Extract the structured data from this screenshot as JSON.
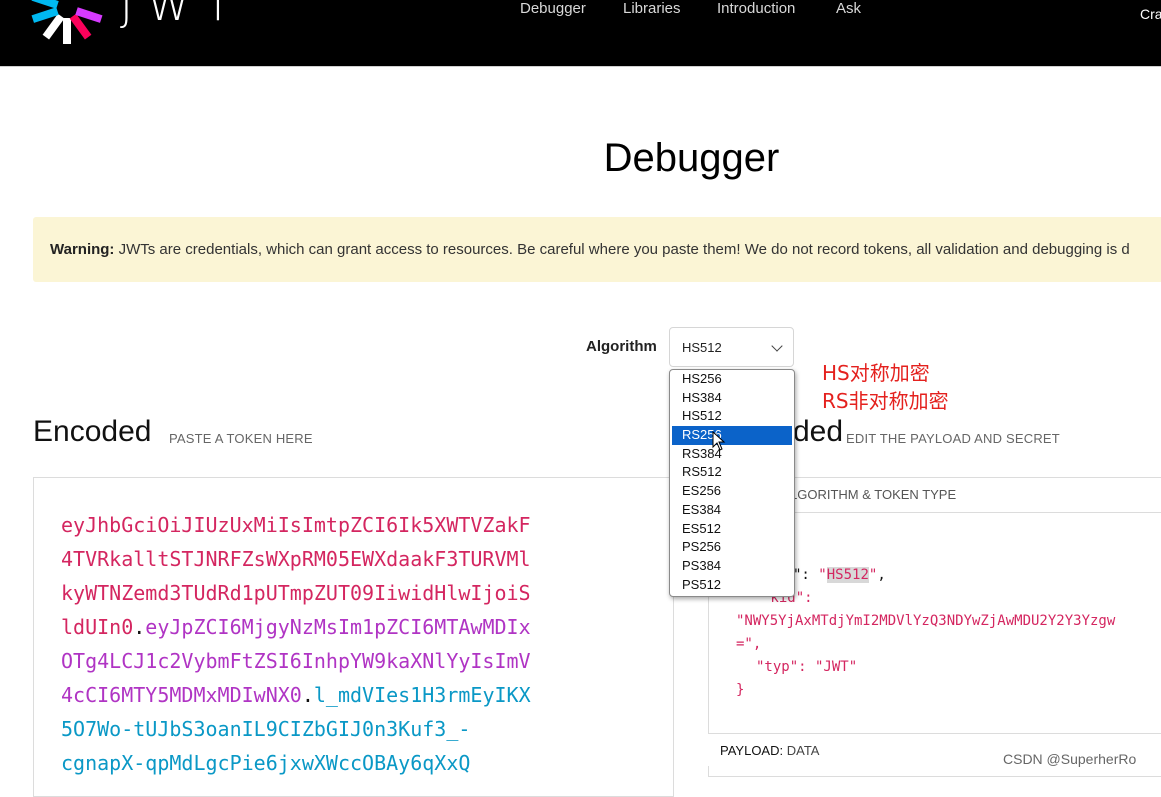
{
  "nav": {
    "brand": "JWT",
    "items": [
      "Debugger",
      "Libraries",
      "Introduction",
      "Ask"
    ],
    "right_label": "Cra"
  },
  "page": {
    "title": "Debugger"
  },
  "warning": {
    "label": "Warning:",
    "text": "JWTs are credentials, which can grant access to resources. Be careful where you paste them! We do not record tokens, all validation and debugging is d"
  },
  "algorithm": {
    "label": "Algorithm",
    "selected": "HS512",
    "options": [
      "HS256",
      "HS384",
      "HS512",
      "RS256",
      "RS384",
      "RS512",
      "ES256",
      "ES384",
      "ES512",
      "PS256",
      "PS384",
      "PS512"
    ],
    "highlighted": "RS256"
  },
  "annotations": {
    "line1": "HS对称加密",
    "line2": "RS非对称加密"
  },
  "encoded": {
    "heading": "Encoded",
    "sub": "PASTE A TOKEN HERE",
    "lines": [
      [
        {
          "t": "eyJhbGciOiJIUzUxMiIsImtpZCI6Ik5XWTVZakF",
          "c": "h"
        }
      ],
      [
        {
          "t": "4TVRkalltSTJNRFZsWXpRM05EWXdaakF3TURVMl",
          "c": "h"
        }
      ],
      [
        {
          "t": "kyWTNZemd3TUdRd1pUTmpZUT09IiwidHlwIjoiS",
          "c": "h"
        }
      ],
      [
        {
          "t": "ldUIn0",
          "c": "h"
        },
        {
          "t": ".",
          "c": "d"
        },
        {
          "t": "eyJpZCI6MjgyNzMsIm1pZCI6MTAwMDIx",
          "c": "p"
        }
      ],
      [
        {
          "t": "OTg4LCJ1c2VybmFtZSI6InhpYW9kaXNlYyIsImV",
          "c": "p"
        }
      ],
      [
        {
          "t": "4cCI6MTY5MDMxMDIwNX0",
          "c": "p"
        },
        {
          "t": ".",
          "c": "d"
        },
        {
          "t": "l_mdVIes1H3rmEyIKX",
          "c": "s"
        }
      ],
      [
        {
          "t": "5O7Wo-tUJbS3oanIL9CIZbGIJ0n3Kuf3_-",
          "c": "s"
        }
      ],
      [
        {
          "t": "cgnapX-qpMdLgcPie6jxwXWccOBAy6qXxQ",
          "c": "s"
        }
      ]
    ]
  },
  "decoded": {
    "heading_visible": "ded",
    "sub": "EDIT THE PAYLOAD AND SECRET",
    "header_label": "LGORITHM & TOKEN TYPE",
    "json_alg_tail": "\": ",
    "alg_value": "HS512",
    "kid_key": "\"kid\":",
    "kid_value": "\"NWY5YjAxMTdjYmI2MDVlYzQ3NDYwZjAwMDU2Y2Y3Yzgw",
    "kid_end": "=\",",
    "typ_line": "\"typ\": \"JWT\"",
    "close": "}",
    "payload_label": "PAYLOAD:",
    "payload_type": "DATA"
  },
  "watermark": "CSDN @SuperherRo"
}
